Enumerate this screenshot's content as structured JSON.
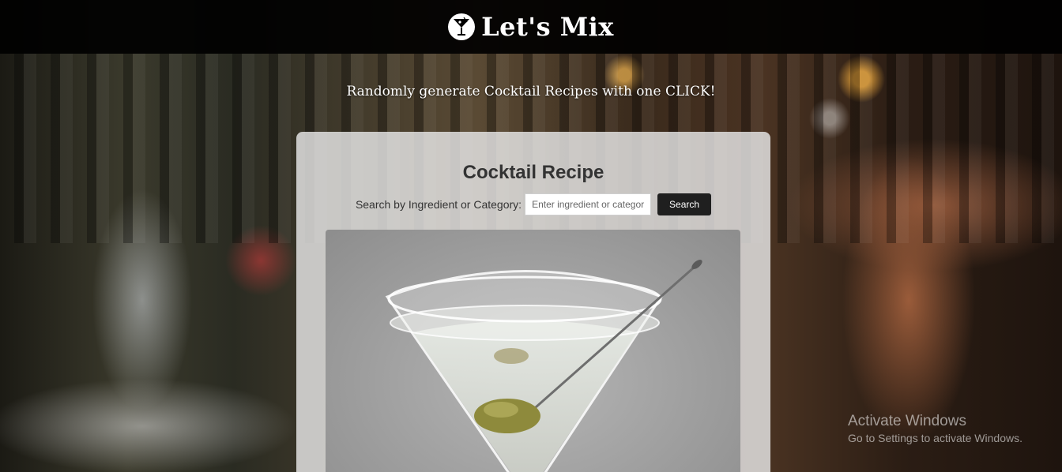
{
  "header": {
    "brand_title": "Let's Mix",
    "logo_icon": "cocktail-glass-icon"
  },
  "tagline": "Randomly generate Cocktail Recipes with one CLICK!",
  "card": {
    "title": "Cocktail Recipe",
    "search": {
      "label": "Search by Ingredient or Category:",
      "placeholder": "Enter ingredient or category",
      "button_label": "Search"
    },
    "image": {
      "subject": "martini-glass-with-olive"
    }
  },
  "watermark": {
    "title": "Activate Windows",
    "subtitle": "Go to Settings to activate Windows."
  },
  "colors": {
    "header_bg": "#000000",
    "button_bg": "#1f1f1f",
    "card_bg": "#e8e8e8"
  }
}
